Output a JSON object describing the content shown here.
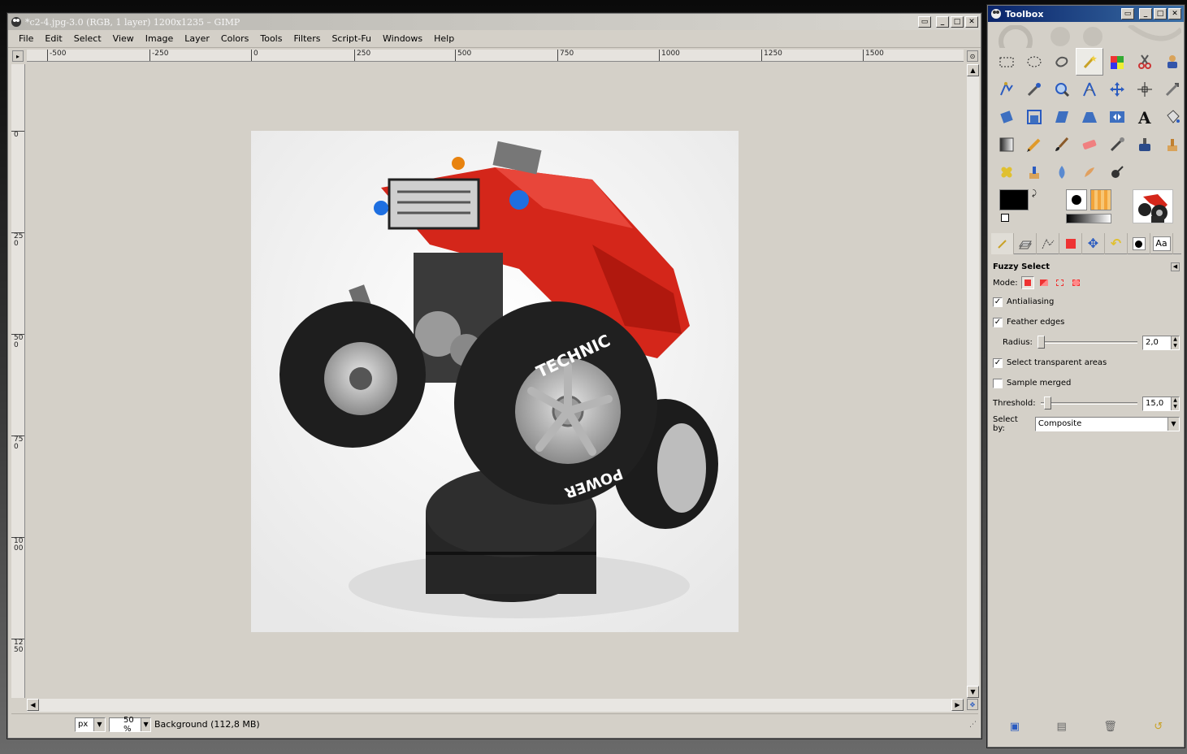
{
  "main_window": {
    "title": "*c2-4.jpg-3.0 (RGB, 1 layer) 1200x1235 – GIMP",
    "menu": [
      "File",
      "Edit",
      "Select",
      "View",
      "Image",
      "Layer",
      "Colors",
      "Tools",
      "Filters",
      "Script-Fu",
      "Windows",
      "Help"
    ],
    "hruler_labels": [
      "-500",
      "-250",
      "0",
      "250",
      "500",
      "750",
      "1000",
      "1250",
      "1500"
    ],
    "vruler_labels": [
      "0",
      "250",
      "500",
      "750",
      "1000",
      "1250"
    ],
    "status": {
      "unit": "px",
      "zoom": "50 %",
      "layer_info": "Background (112,8 MB)"
    },
    "image_text": {
      "tire_top": "TECHNIC",
      "tire_bottom": "POWER"
    }
  },
  "toolbox": {
    "title": "Toolbox",
    "tool_options": {
      "title": "Fuzzy Select",
      "mode_label": "Mode:",
      "antialiasing_label": "Antialiasing",
      "antialiasing": true,
      "feather_edges_label": "Feather edges",
      "feather_edges": true,
      "radius_label": "Radius:",
      "radius_value": "2,0",
      "select_transparent_label": "Select transparent areas",
      "select_transparent": true,
      "sample_merged_label": "Sample merged",
      "sample_merged": false,
      "threshold_label": "Threshold:",
      "threshold_value": "15,0",
      "select_by_label": "Select by:",
      "select_by_value": "Composite"
    },
    "font_tab_label": "Aa",
    "colors": {
      "foreground": "#000000",
      "background": "#ffffff"
    }
  }
}
